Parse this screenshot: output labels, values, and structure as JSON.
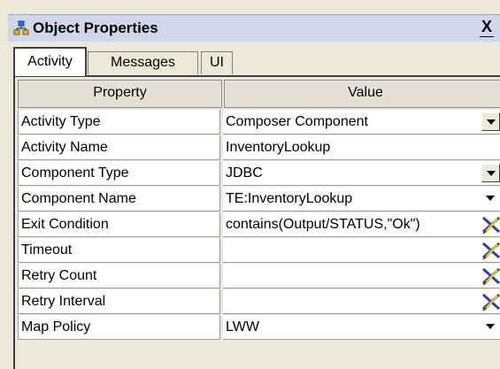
{
  "window": {
    "title": "Object Properties",
    "icon": "object-properties-icon",
    "close_label": "X"
  },
  "tabs": [
    {
      "label": "Activity",
      "active": true
    },
    {
      "label": "Messages",
      "active": false
    },
    {
      "label": "UI",
      "active": false
    }
  ],
  "grid": {
    "columns": [
      "Property",
      "Value"
    ],
    "rows": [
      {
        "property": "Activity Type",
        "value": "Composer Component",
        "control": "dropdown"
      },
      {
        "property": "Activity Name",
        "value": "InventoryLookup",
        "control": "none"
      },
      {
        "property": "Component Type",
        "value": "JDBC",
        "control": "dropdown"
      },
      {
        "property": "Component Name",
        "value": "TE:InventoryLookup",
        "control": "dropdown"
      },
      {
        "property": "Exit Condition",
        "value": "contains(Output/STATUS,\"Ok\")",
        "control": "edit"
      },
      {
        "property": "Timeout",
        "value": "",
        "control": "edit"
      },
      {
        "property": "Retry Count",
        "value": "",
        "control": "edit"
      },
      {
        "property": "Retry Interval",
        "value": "",
        "control": "edit"
      },
      {
        "property": "Map Policy",
        "value": "LWW",
        "control": "dropdown"
      }
    ]
  },
  "colors": {
    "title_bar": "#cfd8ea",
    "panel": "#ece9d8",
    "edit_icon_blue": "#2f3fb0",
    "edit_icon_yellow": "#e8c020"
  }
}
